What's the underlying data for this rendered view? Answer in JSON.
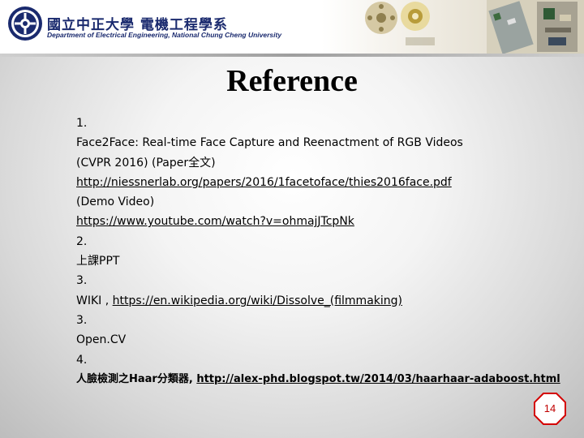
{
  "header": {
    "university_zh": "國立中正大學 電機工程學系",
    "department_en": "Department of Electrical Engineering, National Chung Cheng University"
  },
  "slide": {
    "title": "Reference",
    "lines": [
      "1.",
      "Face2Face: Real-time Face Capture and Reenactment of RGB Videos",
      "(CVPR 2016) (Paper全文)",
      "http://niessnerlab.org/papers/2016/1facetoface/thies2016face.pdf",
      "(Demo Video)",
      "https://www.youtube.com/watch?v=ohmajJTcpNk",
      "2.",
      "上課PPT",
      "3.",
      "WIKI ,",
      "https://en.wikipedia.org/wiki/Dissolve_(filmmaking)",
      "3.",
      "Open.CV",
      "4.",
      "人臉檢測之Haar分類器,",
      "http://alex-phd.blogspot.tw/2014/03/haarhaar-adaboost.html"
    ]
  },
  "page_number": "14",
  "colors": {
    "header_text": "#1a2a6e",
    "page_number": "#c00000"
  }
}
